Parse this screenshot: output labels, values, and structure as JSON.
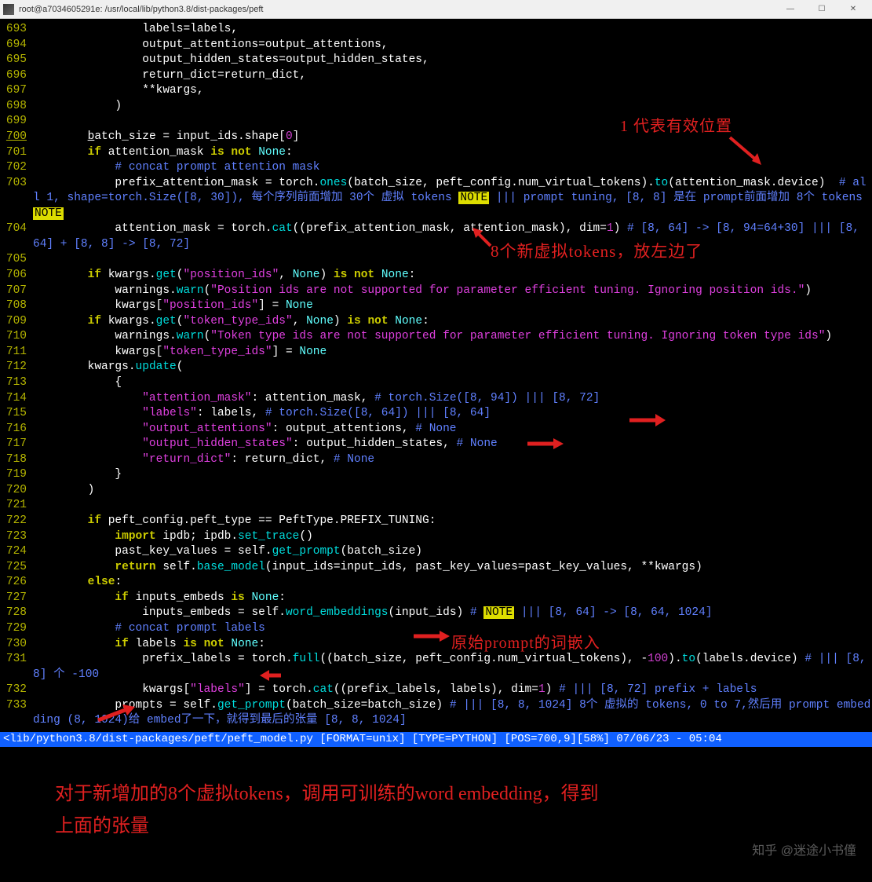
{
  "titlebar": {
    "text": "root@a7034605291e: /usr/local/lib/python3.8/dist-packages/peft"
  },
  "window_controls": {
    "min": "—",
    "max": "☐",
    "close": "✕"
  },
  "lines": [
    {
      "n": "693",
      "html": "                <span>labels=labels,</span>"
    },
    {
      "n": "694",
      "html": "                <span>output_attentions=output_attentions,</span>"
    },
    {
      "n": "695",
      "html": "                <span>output_hidden_states=output_hidden_states,</span>"
    },
    {
      "n": "696",
      "html": "                <span>return_dict=return_dict,</span>"
    },
    {
      "n": "697",
      "html": "                <span>**kwargs,</span>"
    },
    {
      "n": "698",
      "html": "            <span>)</span>"
    },
    {
      "n": "699",
      "html": ""
    },
    {
      "n": "700",
      "u": true,
      "html": "        <span style='text-decoration:underline'>b</span>atch_size = input_ids.shape[<span class='num'>0</span>]"
    },
    {
      "n": "701",
      "html": "        <span class='kw'>if</span> attention_mask <span class='kw'>is</span> <span class='kw'>not</span> <span class='id'>None</span>:"
    },
    {
      "n": "702",
      "html": "            <span class='cmt'># concat prompt attention mask</span>"
    },
    {
      "n": "703",
      "html": "            prefix_attention_mask = torch.<span class='fn'>ones</span>(batch_size, peft_config.num_virtual_tokens).<span class='fn'>to</span>(attention_mask.device)  <span class='cmt'># all 1, shape=torch.Size([8, 30]), 每个序列前面增加 30个 虚拟 tokens </span><span class='note'>NOTE</span><span class='cmt'> ||| prompt tuning, [8, 8] 是在 prompt前面增加 8个 tokens </span><span class='note'>NOTE</span>"
    },
    {
      "n": "704",
      "html": "            attention_mask = torch.<span class='fn'>cat</span>((prefix_attention_mask, attention_mask), dim=<span class='num'>1</span>) <span class='cmt'># [8, 64] -> [8, 94=64+30] ||| [8, 64] + [8, 8] -> [8, 72]</span>"
    },
    {
      "n": "705",
      "html": ""
    },
    {
      "n": "706",
      "html": "        <span class='kw'>if</span> kwargs.<span class='fn'>get</span>(<span class='str'>\"position_ids\"</span>, <span class='id'>None</span>) <span class='kw'>is</span> <span class='kw'>not</span> <span class='id'>None</span>:"
    },
    {
      "n": "707",
      "html": "            warnings.<span class='fn'>warn</span>(<span class='str'>\"Position ids are not supported for parameter efficient tuning. Ignoring position ids.\"</span>)"
    },
    {
      "n": "708",
      "html": "            kwargs[<span class='str'>\"position_ids\"</span>] = <span class='id'>None</span>"
    },
    {
      "n": "709",
      "html": "        <span class='kw'>if</span> kwargs.<span class='fn'>get</span>(<span class='str'>\"token_type_ids\"</span>, <span class='id'>None</span>) <span class='kw'>is</span> <span class='kw'>not</span> <span class='id'>None</span>:"
    },
    {
      "n": "710",
      "html": "            warnings.<span class='fn'>warn</span>(<span class='str'>\"Token type ids are not supported for parameter efficient tuning. Ignoring token type ids\"</span>)"
    },
    {
      "n": "711",
      "html": "            kwargs[<span class='str'>\"token_type_ids\"</span>] = <span class='id'>None</span>"
    },
    {
      "n": "712",
      "html": "        kwargs.<span class='fn'>update</span>("
    },
    {
      "n": "713",
      "html": "            {"
    },
    {
      "n": "714",
      "html": "                <span class='str'>\"attention_mask\"</span>: attention_mask, <span class='cmt'># torch.Size([8, 94]) ||| [8, 72]</span>"
    },
    {
      "n": "715",
      "html": "                <span class='str'>\"labels\"</span>: labels, <span class='cmt'># torch.Size([8, 64]) ||| [8, 64]</span>"
    },
    {
      "n": "716",
      "html": "                <span class='str'>\"output_attentions\"</span>: output_attentions, <span class='cmt'># None</span>"
    },
    {
      "n": "717",
      "html": "                <span class='str'>\"output_hidden_states\"</span>: output_hidden_states, <span class='cmt'># None</span>"
    },
    {
      "n": "718",
      "html": "                <span class='str'>\"return_dict\"</span>: return_dict, <span class='cmt'># None</span>"
    },
    {
      "n": "719",
      "html": "            }"
    },
    {
      "n": "720",
      "html": "        )"
    },
    {
      "n": "721",
      "html": ""
    },
    {
      "n": "722",
      "html": "        <span class='kw'>if</span> peft_config.peft_type == PeftType.PREFIX_TUNING:"
    },
    {
      "n": "723",
      "html": "            <span class='kw'>import</span> ipdb; ipdb.<span class='fn'>set_trace</span>()"
    },
    {
      "n": "724",
      "html": "            past_key_values = self.<span class='fn'>get_prompt</span>(batch_size)"
    },
    {
      "n": "725",
      "html": "            <span class='kw'>return</span> self.<span class='fn'>base_model</span>(input_ids=input_ids, past_key_values=past_key_values, **kwargs)"
    },
    {
      "n": "726",
      "html": "        <span class='kw'>else</span>:"
    },
    {
      "n": "727",
      "html": "            <span class='kw'>if</span> inputs_embeds <span class='kw'>is</span> <span class='id'>None</span>:"
    },
    {
      "n": "728",
      "html": "                inputs_embeds = self.<span class='fn'>word_embeddings</span>(input_ids) <span class='cmt'># </span><span class='note'>NOTE</span><span class='cmt'> ||| [8, 64] -> [8, 64, 1024]</span>"
    },
    {
      "n": "729",
      "html": "            <span class='cmt'># concat prompt labels</span>"
    },
    {
      "n": "730",
      "html": "            <span class='kw'>if</span> labels <span class='kw'>is</span> <span class='kw'>not</span> <span class='id'>None</span>:"
    },
    {
      "n": "731",
      "html": "                prefix_labels = torch.<span class='fn'>full</span>((batch_size, peft_config.num_virtual_tokens), -<span class='num'>100</span>).<span class='fn'>to</span>(labels.device) <span class='cmt'># ||| [8,8] 个 -100</span>"
    },
    {
      "n": "732",
      "html": "                kwargs[<span class='str'>\"labels\"</span>] = torch.<span class='fn'>cat</span>((prefix_labels, labels), dim=<span class='num'>1</span>) <span class='cmt'># ||| [8, 72] prefix + labels</span>"
    },
    {
      "n": "733",
      "html": "            prompts = self.<span class='fn'>get_prompt</span>(batch_size=batch_size) <span class='cmt'># ||| [8, 8, 1024] 8个 虚拟的 tokens, 0 to 7,然后用 prompt embedding (8, 1024)给 embed了一下，就得到最后的张量 [8, 8, 1024]</span>"
    }
  ],
  "statusbar": "<lib/python3.8/dist-packages/peft/peft_model.py [FORMAT=unix] [TYPE=PYTHON] [POS=700,9][58%] 07/06/23 - 05:04",
  "annotations": {
    "a1": "1 代表有效位置",
    "a2": "8个新虚拟tokens，放左边了",
    "a3": "原始prompt的词嵌入",
    "a4": "对于新增加的8个虚拟tokens，调用可训练的word embedding，得到\n上面的张量"
  },
  "watermark": "知乎 @迷途小书僮"
}
